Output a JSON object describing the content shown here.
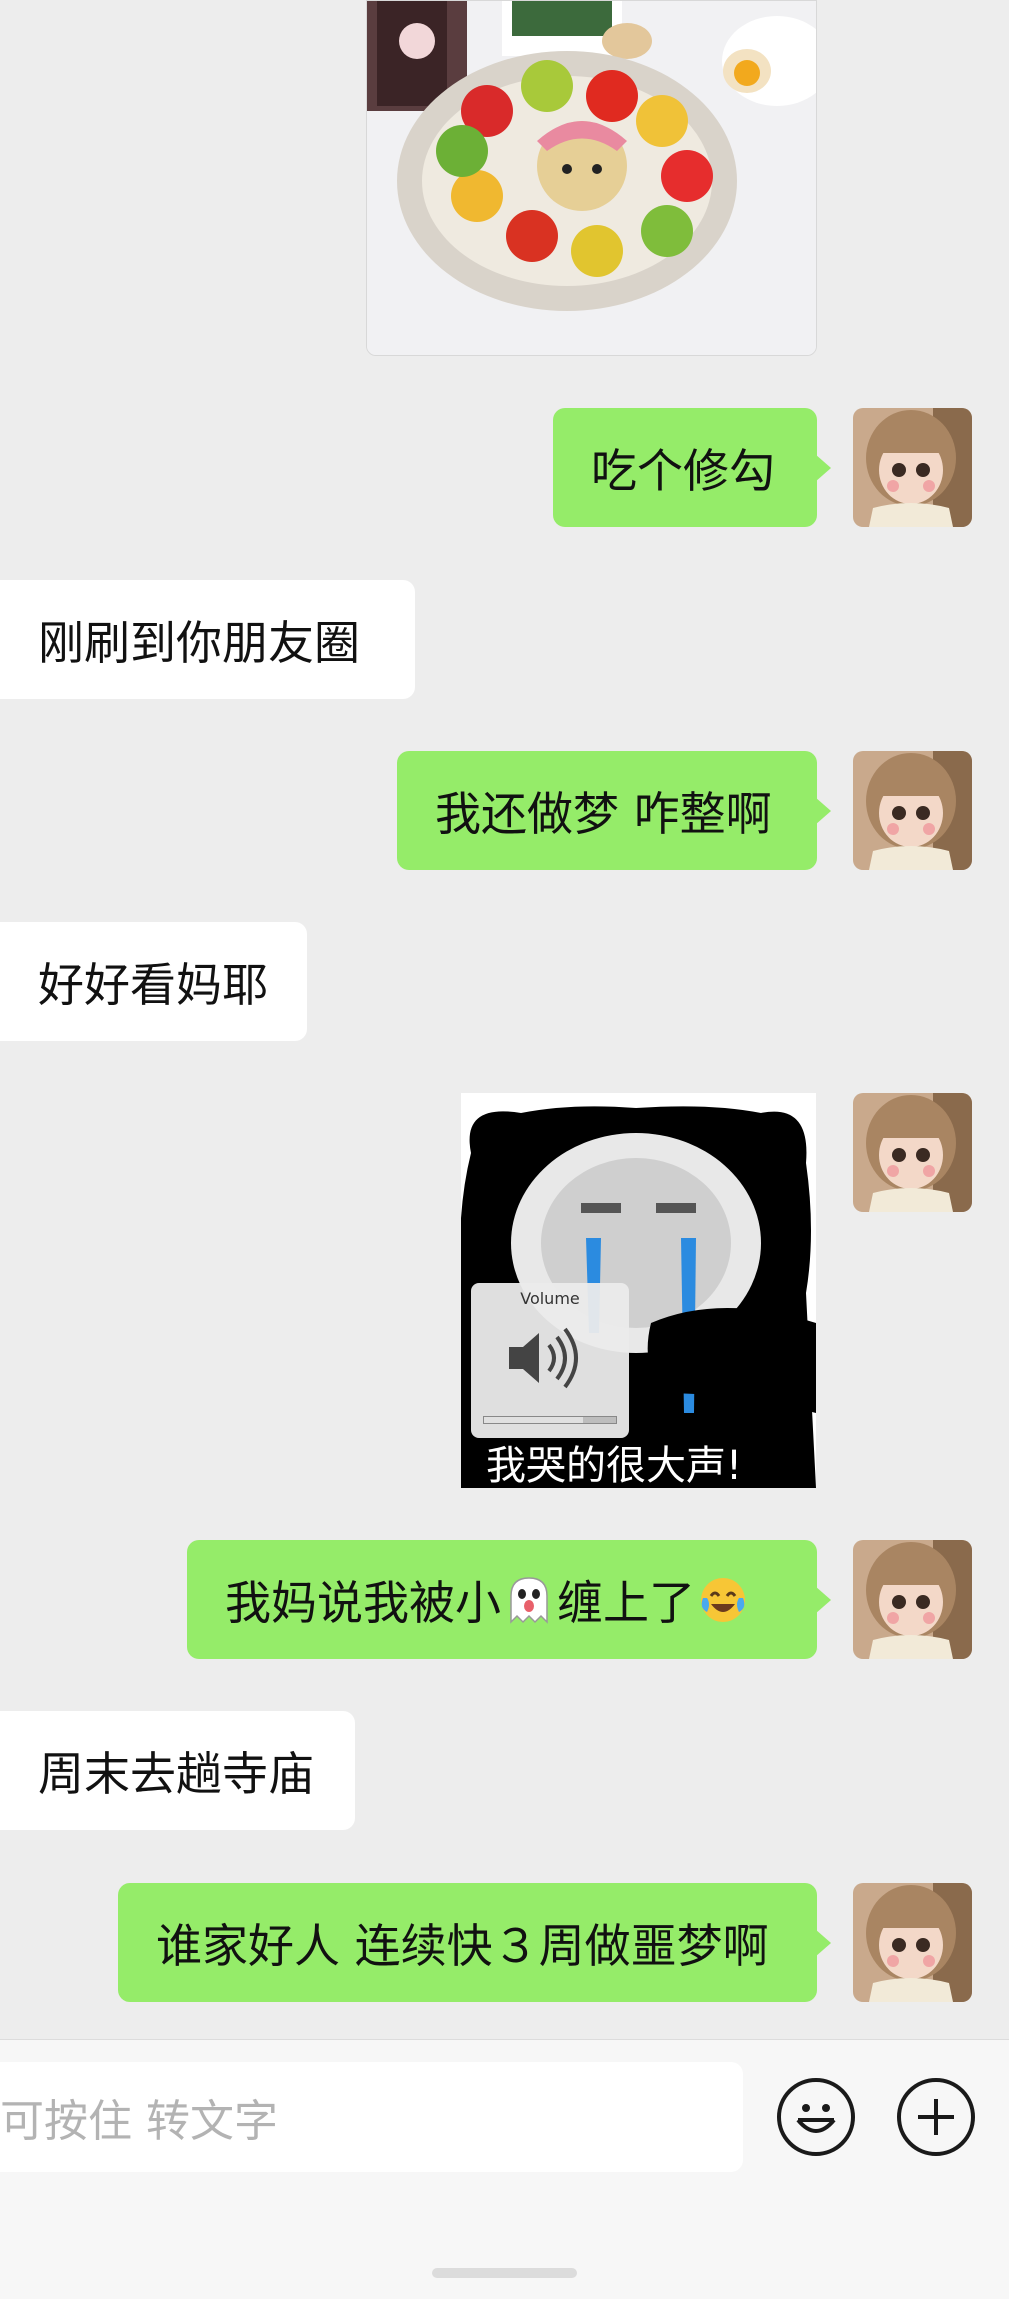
{
  "messages": [
    {
      "type": "image",
      "side": "right",
      "name": "food-photo",
      "description_icon": "food-plate-image"
    },
    {
      "type": "text",
      "side": "right",
      "text": "吃个修勾"
    },
    {
      "type": "text",
      "side": "left",
      "text": "刚刷到你朋友圈"
    },
    {
      "type": "text",
      "side": "right",
      "text": "我还做梦 咋整啊"
    },
    {
      "type": "text",
      "side": "left",
      "text": "好好看妈耶"
    },
    {
      "type": "sticker",
      "side": "right",
      "caption": "我哭的很大声!",
      "overlay_label": "Volume"
    },
    {
      "type": "text",
      "side": "right",
      "text_before": "我妈说我被小",
      "text_mid": "缠上了",
      "emoji_1": "ghost-emoji",
      "emoji_2": "crying-laughing-emoji"
    },
    {
      "type": "text",
      "side": "left",
      "text": "周末去趟寺庙"
    },
    {
      "type": "text",
      "side": "right",
      "text": "谁家好人 连续快３周做噩梦啊"
    }
  ],
  "input_bar": {
    "placeholder": "可按住 转文字",
    "emoji_button_icon": "smiley-icon",
    "more_button_icon": "plus-icon"
  },
  "colors": {
    "background": "#ededed",
    "outgoing_bubble": "#95ec69",
    "incoming_bubble": "#ffffff"
  }
}
